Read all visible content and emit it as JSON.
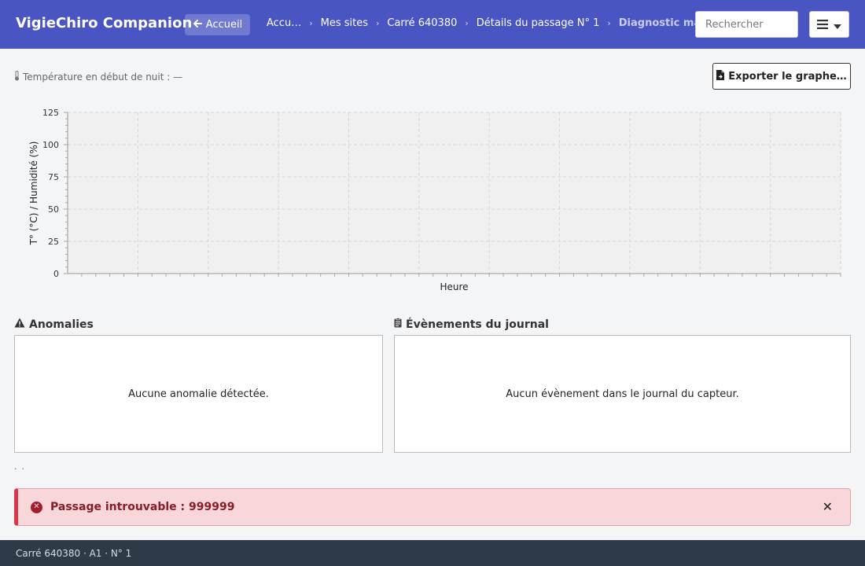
{
  "app": {
    "title": "VigieChiro Companion"
  },
  "header": {
    "home_label": "Accueil",
    "breadcrumbs": [
      "Accu…",
      "Mes sites",
      "Carré 640380",
      "Détails du passage N° 1",
      "Diagnostic matériel"
    ],
    "search_placeholder": "Rechercher"
  },
  "toolbar": {
    "temperature_text": "Température en début de nuit : —",
    "export_label": "Exporter le graphe…"
  },
  "chart_data": {
    "type": "line",
    "title": "",
    "xlabel": "Heure",
    "ylabel": "T° (°C) / Humidité (%)",
    "ylim": [
      0,
      125
    ],
    "yticks": [
      0,
      25,
      50,
      75,
      100,
      125
    ],
    "grid": true,
    "series": []
  },
  "anomalies": {
    "title": "Anomalies",
    "empty_text": "Aucune anomalie détectée."
  },
  "journal": {
    "title": "Évènements du journal",
    "empty_text": "Aucun évènement dans le journal du capteur."
  },
  "alert": {
    "message": "Passage introuvable : 999999",
    "color": "#dc3545"
  },
  "footer": {
    "text": "Carré 640380 · A1 · N° 1"
  },
  "colors": {
    "primary": "#4a55c4",
    "footer": "#2f3a48"
  }
}
